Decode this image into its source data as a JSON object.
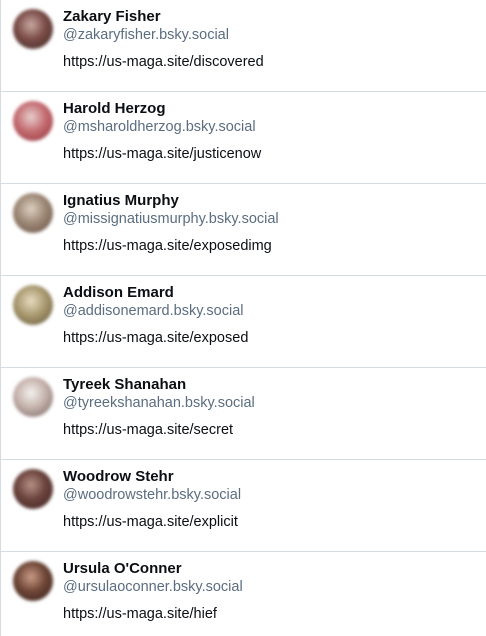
{
  "users": [
    {
      "name": "Zakary Fisher",
      "handle": "@zakaryfisher.bsky.social",
      "bio": "https://us-maga.site/discovered",
      "avatar_colors": [
        "#c9a7a2",
        "#7a4c47",
        "#3a2826"
      ]
    },
    {
      "name": "Harold Herzog",
      "handle": "@msharoldherzog.bsky.social",
      "bio": "https://us-maga.site/justicenow",
      "avatar_colors": [
        "#e7cfcd",
        "#c46d72",
        "#8d2f36"
      ]
    },
    {
      "name": "Ignatius Murphy",
      "handle": "@missignatiusmurphy.bsky.social",
      "bio": "https://us-maga.site/exposedimg",
      "avatar_colors": [
        "#ddd0c1",
        "#9d8775",
        "#5f4c40"
      ]
    },
    {
      "name": "Addison Emard",
      "handle": "@addisonemard.bsky.social",
      "bio": "https://us-maga.site/exposed",
      "avatar_colors": [
        "#e6dcc0",
        "#a9996f",
        "#5e533b"
      ]
    },
    {
      "name": "Tyreek Shanahan",
      "handle": "@tyreekshanahan.bsky.social",
      "bio": "https://us-maga.site/secret",
      "avatar_colors": [
        "#f4f1ee",
        "#c6b3ad",
        "#6e5d5a"
      ]
    },
    {
      "name": "Woodrow Stehr",
      "handle": "@woodrowstehr.bsky.social",
      "bio": "https://us-maga.site/explicit",
      "avatar_colors": [
        "#b69086",
        "#6b433d",
        "#3a2220"
      ]
    },
    {
      "name": "Ursula O'Conner",
      "handle": "@ursulaoconner.bsky.social",
      "bio": "https://us-maga.site/hief",
      "avatar_colors": [
        "#c99b86",
        "#6f4637",
        "#2f1c17"
      ]
    }
  ]
}
